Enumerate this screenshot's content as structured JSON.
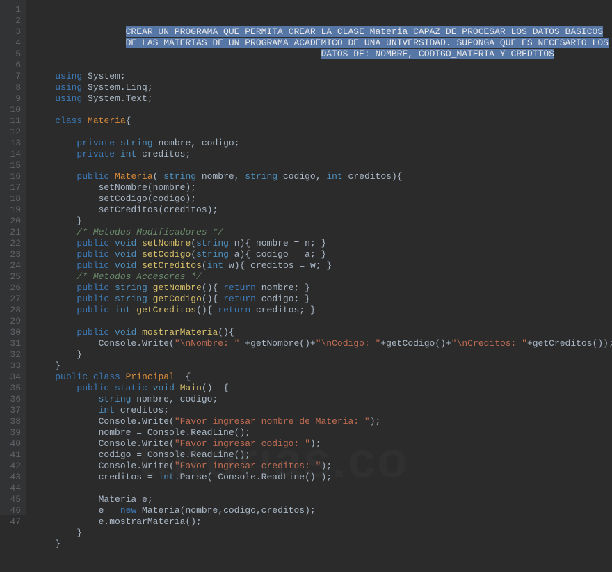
{
  "watermark": "tutorias.co",
  "lineNumbers": [
    "1",
    "2",
    "3",
    "4",
    "5",
    "6",
    "7",
    "8",
    "9",
    "10",
    "11",
    "12",
    "13",
    "14",
    "15",
    "16",
    "17",
    "18",
    "19",
    "20",
    "21",
    "22",
    "23",
    "24",
    "25",
    "26",
    "27",
    "28",
    "29",
    "30",
    "31",
    "32",
    "33",
    "34",
    "35",
    "36",
    "37",
    "38",
    "39",
    "40",
    "41",
    "42",
    "43",
    "44",
    "45",
    "46",
    "47"
  ],
  "lines": [
    {
      "indent": "                 ",
      "segs": [
        {
          "t": "CREAR UN PROGRAMA QUE PERMITA CREAR LA CLASE Materia CAPAZ DE PROCESAR LOS DATOS BASICOS",
          "c": "sel"
        }
      ]
    },
    {
      "indent": "                 ",
      "segs": [
        {
          "t": "DE LAS MATERIAS DE UN PROGRAMA ACADEMICO DE UNA UNIVERSIDAD. SUPONGA QUE ES NECESARIO LOS",
          "c": "sel"
        }
      ]
    },
    {
      "indent": "                                                     ",
      "segs": [
        {
          "t": "DATOS DE: NOMBRE, CODIGO_MATERIA Y CREDITOS",
          "c": "sel"
        }
      ]
    },
    {
      "indent": "",
      "segs": []
    },
    {
      "indent": "    ",
      "segs": [
        {
          "t": "using",
          "c": "kw"
        },
        {
          "t": " System;",
          "c": "fg"
        }
      ]
    },
    {
      "indent": "    ",
      "segs": [
        {
          "t": "using",
          "c": "kw"
        },
        {
          "t": " System.Linq;",
          "c": "fg"
        }
      ]
    },
    {
      "indent": "    ",
      "segs": [
        {
          "t": "using",
          "c": "kw"
        },
        {
          "t": " System.Text;",
          "c": "fg"
        }
      ]
    },
    {
      "indent": "",
      "segs": []
    },
    {
      "indent": "    ",
      "segs": [
        {
          "t": "class",
          "c": "kw"
        },
        {
          "t": " ",
          "c": "fg"
        },
        {
          "t": "Materia",
          "c": "cls"
        },
        {
          "t": "{",
          "c": "fg"
        }
      ]
    },
    {
      "indent": "",
      "segs": []
    },
    {
      "indent": "        ",
      "segs": [
        {
          "t": "private",
          "c": "kw"
        },
        {
          "t": " ",
          "c": "fg"
        },
        {
          "t": "string",
          "c": "type"
        },
        {
          "t": " nombre, codigo;",
          "c": "fg"
        }
      ]
    },
    {
      "indent": "        ",
      "segs": [
        {
          "t": "private",
          "c": "kw"
        },
        {
          "t": " ",
          "c": "fg"
        },
        {
          "t": "int",
          "c": "type"
        },
        {
          "t": " creditos;",
          "c": "fg"
        }
      ]
    },
    {
      "indent": "",
      "segs": []
    },
    {
      "indent": "        ",
      "segs": [
        {
          "t": "public",
          "c": "kw"
        },
        {
          "t": " ",
          "c": "fg"
        },
        {
          "t": "Materia",
          "c": "cls"
        },
        {
          "t": "( ",
          "c": "fg"
        },
        {
          "t": "string",
          "c": "type"
        },
        {
          "t": " nombre, ",
          "c": "fg"
        },
        {
          "t": "string",
          "c": "type"
        },
        {
          "t": " codigo, ",
          "c": "fg"
        },
        {
          "t": "int",
          "c": "type"
        },
        {
          "t": " creditos){",
          "c": "fg"
        }
      ]
    },
    {
      "indent": "            ",
      "segs": [
        {
          "t": "setNombre(nombre);",
          "c": "fg"
        }
      ]
    },
    {
      "indent": "            ",
      "segs": [
        {
          "t": "setCodigo(codigo);",
          "c": "fg"
        }
      ]
    },
    {
      "indent": "            ",
      "segs": [
        {
          "t": "setCreditos(creditos);",
          "c": "fg"
        }
      ]
    },
    {
      "indent": "        ",
      "segs": [
        {
          "t": "}",
          "c": "fg"
        }
      ]
    },
    {
      "indent": "        ",
      "segs": [
        {
          "t": "/* Metodos Modificadores */",
          "c": "cmt"
        }
      ]
    },
    {
      "indent": "        ",
      "segs": [
        {
          "t": "public",
          "c": "kw"
        },
        {
          "t": " ",
          "c": "fg"
        },
        {
          "t": "void",
          "c": "type"
        },
        {
          "t": " ",
          "c": "fg"
        },
        {
          "t": "setNombre",
          "c": "method"
        },
        {
          "t": "(",
          "c": "fg"
        },
        {
          "t": "string",
          "c": "type"
        },
        {
          "t": " n){ nombre = n; }",
          "c": "fg"
        }
      ]
    },
    {
      "indent": "        ",
      "segs": [
        {
          "t": "public",
          "c": "kw"
        },
        {
          "t": " ",
          "c": "fg"
        },
        {
          "t": "void",
          "c": "type"
        },
        {
          "t": " ",
          "c": "fg"
        },
        {
          "t": "setCodigo",
          "c": "method"
        },
        {
          "t": "(",
          "c": "fg"
        },
        {
          "t": "string",
          "c": "type"
        },
        {
          "t": " a){ codigo = a; }",
          "c": "fg"
        }
      ]
    },
    {
      "indent": "        ",
      "segs": [
        {
          "t": "public",
          "c": "kw"
        },
        {
          "t": " ",
          "c": "fg"
        },
        {
          "t": "void",
          "c": "type"
        },
        {
          "t": " ",
          "c": "fg"
        },
        {
          "t": "setCreditos",
          "c": "method"
        },
        {
          "t": "(",
          "c": "fg"
        },
        {
          "t": "int",
          "c": "type"
        },
        {
          "t": " w){ creditos = w; }",
          "c": "fg"
        }
      ]
    },
    {
      "indent": "        ",
      "segs": [
        {
          "t": "/* Metodos Accesores */",
          "c": "cmt"
        }
      ]
    },
    {
      "indent": "        ",
      "segs": [
        {
          "t": "public",
          "c": "kw"
        },
        {
          "t": " ",
          "c": "fg"
        },
        {
          "t": "string",
          "c": "type"
        },
        {
          "t": " ",
          "c": "fg"
        },
        {
          "t": "getNombre",
          "c": "method"
        },
        {
          "t": "(){ ",
          "c": "fg"
        },
        {
          "t": "return",
          "c": "kw"
        },
        {
          "t": " nombre; }",
          "c": "fg"
        }
      ]
    },
    {
      "indent": "        ",
      "segs": [
        {
          "t": "public",
          "c": "kw"
        },
        {
          "t": " ",
          "c": "fg"
        },
        {
          "t": "string",
          "c": "type"
        },
        {
          "t": " ",
          "c": "fg"
        },
        {
          "t": "getCodigo",
          "c": "method"
        },
        {
          "t": "(){ ",
          "c": "fg"
        },
        {
          "t": "return",
          "c": "kw"
        },
        {
          "t": " codigo; }",
          "c": "fg"
        }
      ]
    },
    {
      "indent": "        ",
      "segs": [
        {
          "t": "public",
          "c": "kw"
        },
        {
          "t": " ",
          "c": "fg"
        },
        {
          "t": "int",
          "c": "type"
        },
        {
          "t": " ",
          "c": "fg"
        },
        {
          "t": "getCreditos",
          "c": "method"
        },
        {
          "t": "(){ ",
          "c": "fg"
        },
        {
          "t": "return",
          "c": "kw"
        },
        {
          "t": " creditos; }",
          "c": "fg"
        }
      ]
    },
    {
      "indent": "",
      "segs": []
    },
    {
      "indent": "        ",
      "segs": [
        {
          "t": "public",
          "c": "kw"
        },
        {
          "t": " ",
          "c": "fg"
        },
        {
          "t": "void",
          "c": "type"
        },
        {
          "t": " ",
          "c": "fg"
        },
        {
          "t": "mostrarMateria",
          "c": "method"
        },
        {
          "t": "(){",
          "c": "fg"
        }
      ]
    },
    {
      "indent": "            ",
      "segs": [
        {
          "t": "Console.Write(",
          "c": "fg"
        },
        {
          "t": "\"\\nNombre: \"",
          "c": "str"
        },
        {
          "t": " +getNombre()+",
          "c": "fg"
        },
        {
          "t": "\"\\nCodigo: \"",
          "c": "str"
        },
        {
          "t": "+getCodigo()+",
          "c": "fg"
        },
        {
          "t": "\"\\nCreditos: \"",
          "c": "str"
        },
        {
          "t": "+getCreditos());",
          "c": "fg"
        }
      ]
    },
    {
      "indent": "        ",
      "segs": [
        {
          "t": "}",
          "c": "fg"
        }
      ]
    },
    {
      "indent": "    ",
      "segs": [
        {
          "t": "}",
          "c": "fg"
        }
      ]
    },
    {
      "indent": "    ",
      "segs": [
        {
          "t": "public",
          "c": "kw"
        },
        {
          "t": " ",
          "c": "fg"
        },
        {
          "t": "class",
          "c": "kw"
        },
        {
          "t": " ",
          "c": "fg"
        },
        {
          "t": "Principal",
          "c": "cls"
        },
        {
          "t": "  {",
          "c": "fg"
        }
      ]
    },
    {
      "indent": "        ",
      "segs": [
        {
          "t": "public",
          "c": "kw"
        },
        {
          "t": " ",
          "c": "fg"
        },
        {
          "t": "static",
          "c": "kw"
        },
        {
          "t": " ",
          "c": "fg"
        },
        {
          "t": "void",
          "c": "type"
        },
        {
          "t": " ",
          "c": "fg"
        },
        {
          "t": "Main",
          "c": "method"
        },
        {
          "t": "()  {",
          "c": "fg"
        }
      ]
    },
    {
      "indent": "            ",
      "segs": [
        {
          "t": "string",
          "c": "type"
        },
        {
          "t": " nombre, codigo;",
          "c": "fg"
        }
      ]
    },
    {
      "indent": "            ",
      "segs": [
        {
          "t": "int",
          "c": "type"
        },
        {
          "t": " creditos;",
          "c": "fg"
        }
      ]
    },
    {
      "indent": "            ",
      "segs": [
        {
          "t": "Console.Write(",
          "c": "fg"
        },
        {
          "t": "\"Favor ingresar nombre de Materia: \"",
          "c": "str"
        },
        {
          "t": ");",
          "c": "fg"
        }
      ]
    },
    {
      "indent": "            ",
      "segs": [
        {
          "t": "nombre = Console.ReadLine();",
          "c": "fg"
        }
      ]
    },
    {
      "indent": "            ",
      "segs": [
        {
          "t": "Console.Write(",
          "c": "fg"
        },
        {
          "t": "\"Favor ingresar codigo: \"",
          "c": "str"
        },
        {
          "t": ");",
          "c": "fg"
        }
      ]
    },
    {
      "indent": "            ",
      "segs": [
        {
          "t": "codigo = Console.ReadLine();",
          "c": "fg"
        }
      ]
    },
    {
      "indent": "            ",
      "segs": [
        {
          "t": "Console.Write(",
          "c": "fg"
        },
        {
          "t": "\"Favor ingresar creditos: \"",
          "c": "str"
        },
        {
          "t": ");",
          "c": "fg"
        }
      ]
    },
    {
      "indent": "            ",
      "segs": [
        {
          "t": "creditos = ",
          "c": "fg"
        },
        {
          "t": "int",
          "c": "type"
        },
        {
          "t": ".Parse( Console.ReadLine() );",
          "c": "fg"
        }
      ]
    },
    {
      "indent": "",
      "segs": []
    },
    {
      "indent": "            ",
      "segs": [
        {
          "t": "Materia e;",
          "c": "fg"
        }
      ]
    },
    {
      "indent": "            ",
      "segs": [
        {
          "t": "e = ",
          "c": "fg"
        },
        {
          "t": "new",
          "c": "kw"
        },
        {
          "t": " Materia(nombre,codigo,creditos);",
          "c": "fg"
        }
      ]
    },
    {
      "indent": "            ",
      "segs": [
        {
          "t": "e.mostrarMateria();",
          "c": "fg"
        }
      ]
    },
    {
      "indent": "        ",
      "segs": [
        {
          "t": "}",
          "c": "fg"
        }
      ]
    },
    {
      "indent": "    ",
      "segs": [
        {
          "t": "}",
          "c": "fg"
        }
      ]
    }
  ]
}
